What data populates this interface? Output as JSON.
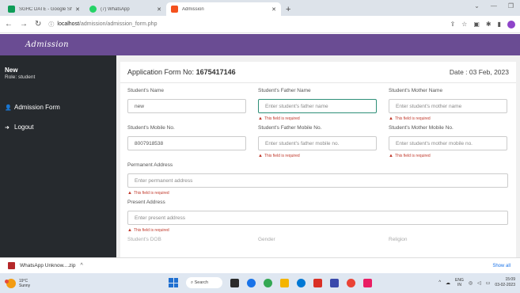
{
  "browser": {
    "tabs": [
      {
        "title": "SGHC DATE - Google Sheets",
        "color": "#0f9d58",
        "active": false
      },
      {
        "title": "(7) WhatsApp",
        "color": "#25d366",
        "active": false
      },
      {
        "title": "Admission",
        "color": "#f4511e",
        "active": true
      }
    ],
    "new_tab": "+",
    "url_host": "localhost",
    "url_path": "/admission/admission_form.php"
  },
  "app": {
    "brand": "Admission",
    "accent": "#6a4c93",
    "sidebar_bg": "#262a2e"
  },
  "sidebar": {
    "user_name": "New",
    "user_role": "Role: student",
    "items": [
      {
        "label": "Admission Form",
        "icon": "user-icon"
      },
      {
        "label": "Logout",
        "icon": "logout-icon"
      }
    ]
  },
  "form": {
    "title_prefix": "Application Form No:",
    "number": "1675417146",
    "date": "Date : 03 Feb, 2023",
    "error_text": "This field is required",
    "error_color": "#c0392b",
    "fields": {
      "student_name": {
        "label": "Student's Name",
        "value": "new"
      },
      "father_name": {
        "label": "Student's Father Name",
        "placeholder": "Enter student's father name"
      },
      "mother_name": {
        "label": "Student's Mother Name",
        "placeholder": "Enter student's mother name"
      },
      "student_mobile": {
        "label": "Student's Mobile No.",
        "value": "8007918538"
      },
      "father_mobile": {
        "label": "Student's Father Mobile No.",
        "placeholder": "Enter student's father mobile no."
      },
      "mother_mobile": {
        "label": "Student's Mother Mobile No.",
        "placeholder": "Enter student's mother mobile no."
      },
      "permanent_address": {
        "label": "Permanent Address",
        "placeholder": "Enter permanent address"
      },
      "present_address": {
        "label": "Present Address",
        "placeholder": "Enter present address"
      }
    },
    "cut_labels": [
      "Student's DOB",
      "Gender",
      "Religion"
    ]
  },
  "downloads": {
    "file": "WhatsApp Unknow....zip",
    "show_all": "Show all"
  },
  "taskbar": {
    "temp": "19°C",
    "weather": "Sunny",
    "search": "Search",
    "lang1": "ENG",
    "lang2": "IN",
    "time": "15:09",
    "date": "03-02-2023"
  }
}
